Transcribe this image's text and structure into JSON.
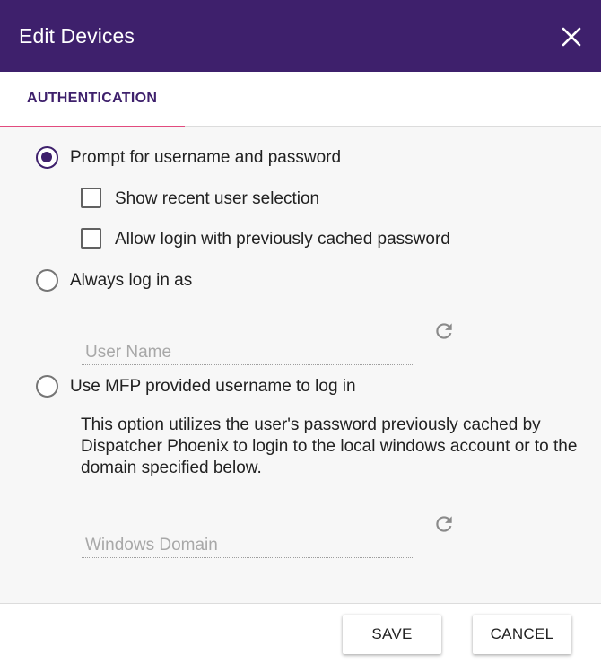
{
  "dialog": {
    "title": "Edit Devices",
    "colors": {
      "header": "#3e206c",
      "tab_indicator": "#e24a7e",
      "accent": "#3e206c"
    }
  },
  "tabs": [
    {
      "label": "AUTHENTICATION",
      "active": true
    }
  ],
  "auth": {
    "prompt_option": {
      "label": "Prompt for username and password",
      "selected": true
    },
    "show_recent": {
      "label": "Show recent user selection",
      "checked": false
    },
    "allow_cached": {
      "label": "Allow login with previously cached password",
      "checked": false
    },
    "always_login": {
      "label": "Always log in as",
      "selected": false
    },
    "username_field": {
      "placeholder": "User Name",
      "value": ""
    },
    "mfp_option": {
      "label": "Use MFP provided username to log in",
      "selected": false
    },
    "mfp_description": "This option utilizes the user's password previously cached by Dispatcher Phoenix to login to the local windows account or to the domain specified below.",
    "domain_field": {
      "placeholder": "Windows Domain",
      "value": ""
    }
  },
  "footer": {
    "save_label": "SAVE",
    "cancel_label": "CANCEL"
  },
  "icons": {
    "close": "close-icon",
    "refresh": "refresh-icon"
  }
}
